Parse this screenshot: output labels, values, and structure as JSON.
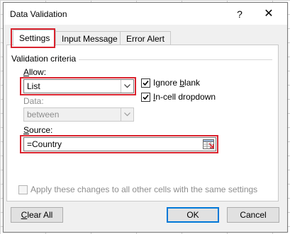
{
  "dialog": {
    "title": "Data Validation",
    "help_label": "?",
    "close_label": "✕"
  },
  "tabs": [
    {
      "label": "Settings",
      "active": true
    },
    {
      "label": "Input Message",
      "active": false
    },
    {
      "label": "Error Alert",
      "active": false
    }
  ],
  "criteria": {
    "group_label": "Validation criteria",
    "allow_label_u": "A",
    "allow_label_rest": "llow:",
    "allow_value": "List",
    "data_label": "Data:",
    "data_value": "between",
    "ignore_blank_prefix": "Ignore ",
    "ignore_blank_u": "b",
    "ignore_blank_rest": "lank",
    "ignore_blank_checked": true,
    "incell_u": "I",
    "incell_rest": "n-cell dropdown",
    "incell_checked": true,
    "source_label_u": "S",
    "source_label_rest": "ource:",
    "source_value": "=Country"
  },
  "apply_all": {
    "label": "Apply these changes to all other cells with the same settings",
    "checked": false,
    "enabled": false
  },
  "buttons": {
    "clear_all_u": "C",
    "clear_all_rest": "lear All",
    "ok": "OK",
    "cancel": "Cancel"
  },
  "colors": {
    "highlight": "#d9232e",
    "default_button_border": "#0078d7"
  },
  "icons": [
    "help-icon",
    "close-icon",
    "chevron-down-icon",
    "checkmark-icon",
    "range-select-icon"
  ]
}
